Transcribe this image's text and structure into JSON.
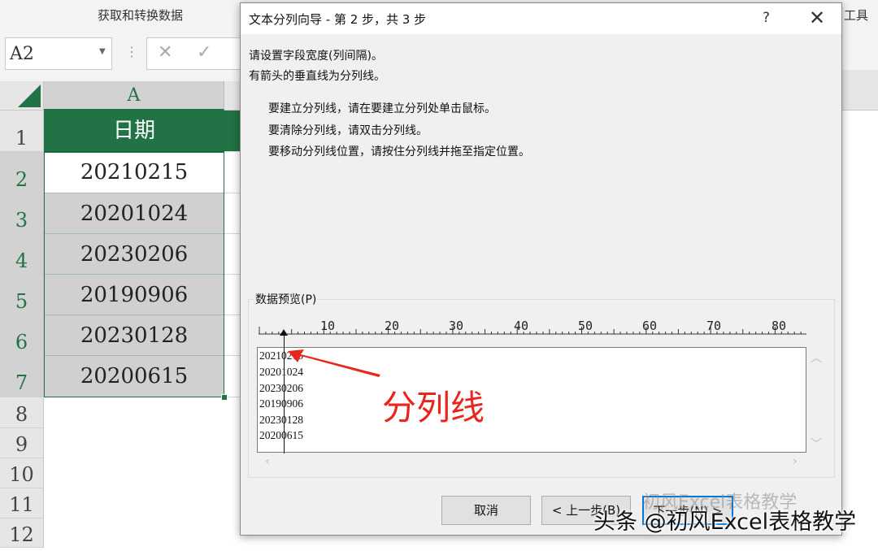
{
  "ribbon": {
    "group_label": "获取和转换数据",
    "right_label": "工具"
  },
  "formula_bar": {
    "name_box": "A2",
    "dots": "⋮",
    "cancel": "✕",
    "enter": "✓"
  },
  "sheet": {
    "column_header": "A",
    "rows": [
      {
        "num": "1",
        "value": "日期"
      },
      {
        "num": "2",
        "value": "20210215"
      },
      {
        "num": "3",
        "value": "20201024"
      },
      {
        "num": "4",
        "value": "20230206"
      },
      {
        "num": "5",
        "value": "20190906"
      },
      {
        "num": "6",
        "value": "20230128"
      },
      {
        "num": "7",
        "value": "20200615"
      },
      {
        "num": "8",
        "value": ""
      },
      {
        "num": "9",
        "value": ""
      },
      {
        "num": "10",
        "value": ""
      },
      {
        "num": "11",
        "value": ""
      },
      {
        "num": "12",
        "value": ""
      }
    ],
    "header_color": "#217346"
  },
  "dialog": {
    "title": "文本分列向导 - 第 2 步，共 3 步",
    "help": "?",
    "close": "✕",
    "line1": "请设置字段宽度(列间隔)。",
    "line2": "有箭头的垂直线为分列线。",
    "instr1": "要建立分列线，请在要建立分列处单击鼠标。",
    "instr2": "要清除分列线，请双击分列线。",
    "instr3": "要移动分列线位置，请按住分列线并拖至指定位置。",
    "preview_label": "数据预览(P)",
    "ruler_numbers": [
      "10",
      "20",
      "30",
      "40",
      "50",
      "60",
      "70",
      "80"
    ],
    "preview_lines": [
      "20210215",
      "20201024",
      "20230206",
      "20190906",
      "20230128",
      "20200615"
    ],
    "buttons": {
      "cancel": "取消",
      "back": "< 上一步(B)",
      "next": "下一步(N) >"
    }
  },
  "annotation": {
    "text": "分列线",
    "color": "#e8261e"
  },
  "watermark": {
    "top": "初风Excel表格教学",
    "bottom": "头条 @初风Excel表格教学"
  }
}
